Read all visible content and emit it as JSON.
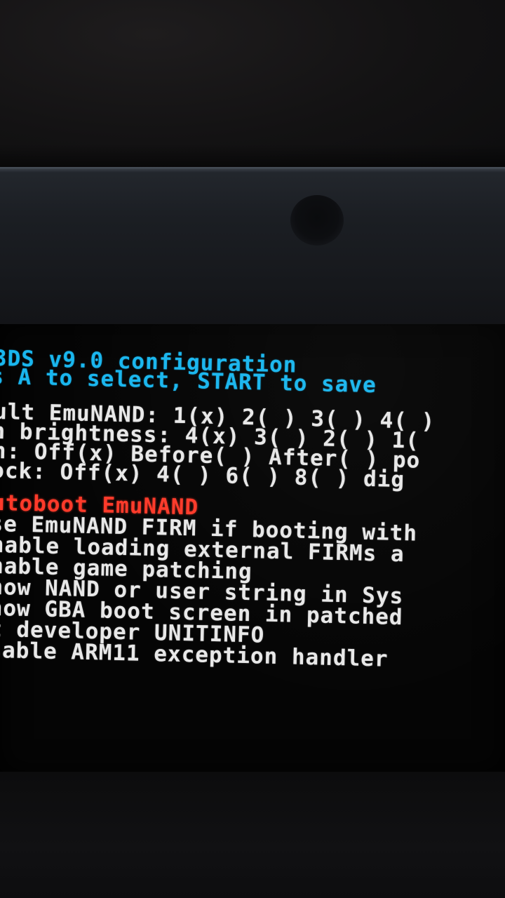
{
  "screen": {
    "header_lines": [
      "3DS v9.0 configuration",
      "s A to select, START to save"
    ],
    "option_lines": [
      "ult EmuNAND: 1(x) 2( ) 3( ) 4( )",
      "n brightness: 4(x) 3( ) 2( ) 1(",
      "h: Off(x) Before( ) After( ) po",
      "ock: Off(x) 4( ) 6( ) 8( ) dig"
    ],
    "toggle_lines": [
      "utoboot EmuNAND",
      "se EmuNAND FIRM if booting with",
      "nable loading external FIRMs a",
      "nable game patching",
      "how NAND or user string in Sys",
      "how GBA boot screen in patched",
      "t developer UNITINFO",
      "sable ARM11 exception handler"
    ],
    "selected_index": 0
  },
  "colors": {
    "header": "#19b6ee",
    "option": "#e8e8e8",
    "selected": "#ff3a2a"
  }
}
